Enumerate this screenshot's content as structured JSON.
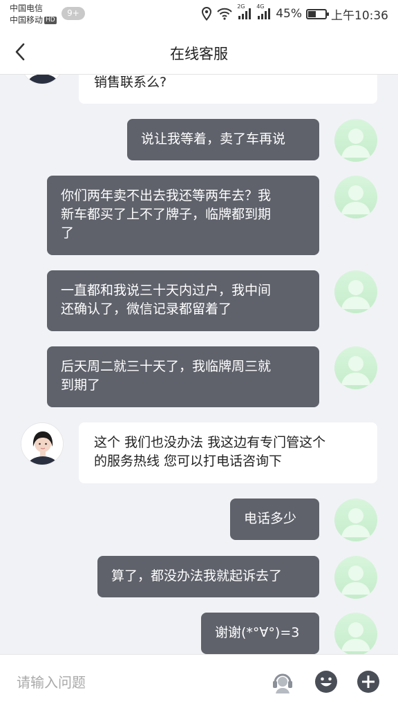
{
  "status_bar": {
    "carrier_1": "中国电信",
    "carrier_2": "中国移动",
    "hd_badge": "HD",
    "notification_badge": "9+",
    "network_1": "2G",
    "network_2": "4G",
    "battery_percent_text": "45%",
    "battery_level": 0.45,
    "time": "上午10:36"
  },
  "nav": {
    "title": "在线客服"
  },
  "messages": [
    {
      "from": "agent",
      "lines": [
        "销售联系么?"
      ]
    },
    {
      "from": "user",
      "lines": [
        "说让我等着，卖了车再说"
      ]
    },
    {
      "from": "user",
      "lines": [
        "你们两年卖不出去我还等两年去？我",
        "新车都买了上不了牌子，临牌都到期",
        "了"
      ]
    },
    {
      "from": "user",
      "lines": [
        "一直都和我说三十天内过户，我中间",
        "还确认了，微信记录都留着了"
      ]
    },
    {
      "from": "user",
      "lines": [
        "后天周二就三十天了，我临牌周三就",
        "到期了"
      ]
    },
    {
      "from": "agent",
      "lines": [
        "这个 我们也没办法 我这边有专门管这个",
        "的服务热线 您可以打电话咨询下"
      ]
    },
    {
      "from": "user",
      "lines": [
        "电话多少"
      ]
    },
    {
      "from": "user",
      "lines": [
        "算了，都没办法我就起诉去了"
      ]
    },
    {
      "from": "user",
      "lines": [
        "谢谢(*°∀°)=3"
      ]
    }
  ],
  "input": {
    "placeholder": "请输入问题"
  },
  "icons": {
    "back": "chevron-left-icon",
    "location": "location-icon",
    "wifi": "wifi-icon",
    "signal": "signal-icon",
    "battery": "battery-icon",
    "agent_service": "customer-service-icon",
    "emoji": "emoji-icon",
    "add": "plus-icon"
  },
  "colors": {
    "user_bubble": "#5f626b",
    "agent_bubble": "#ffffff",
    "background": "#f1f2f6",
    "user_avatar": "#c9efcf"
  }
}
